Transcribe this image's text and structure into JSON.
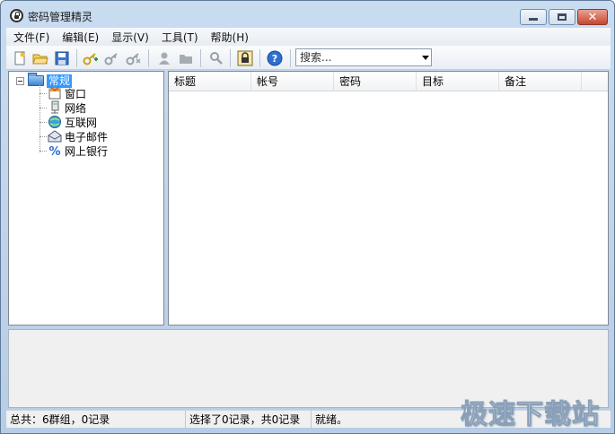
{
  "window": {
    "title": "密码管理精灵"
  },
  "menu": [
    {
      "label": "文件(F)"
    },
    {
      "label": "编辑(E)"
    },
    {
      "label": "显示(V)"
    },
    {
      "label": "工具(T)"
    },
    {
      "label": "帮助(H)"
    }
  ],
  "toolbar": {
    "search_value": "搜索...",
    "icons": [
      "new-file-icon",
      "open-folder-icon",
      "save-icon",
      "add-key-icon",
      "edit-key-icon",
      "delete-key-icon",
      "user-icon",
      "folder-gray-icon",
      "find-icon",
      "lock-icon",
      "help-icon"
    ]
  },
  "tree": {
    "root": "常规",
    "children": [
      {
        "label": "窗口",
        "icon": "window-icon"
      },
      {
        "label": "网络",
        "icon": "network-icon"
      },
      {
        "label": "互联网",
        "icon": "internet-icon"
      },
      {
        "label": "电子邮件",
        "icon": "email-icon"
      },
      {
        "label": "网上银行",
        "icon": "bank-icon"
      }
    ]
  },
  "table": {
    "columns": [
      "标题",
      "帐号",
      "密码",
      "目标",
      "备注"
    ]
  },
  "status": {
    "total": "总共：6群组，0记录",
    "selection": "选择了0记录，共0记录",
    "state": "就绪。"
  },
  "watermark": "极速下载站"
}
